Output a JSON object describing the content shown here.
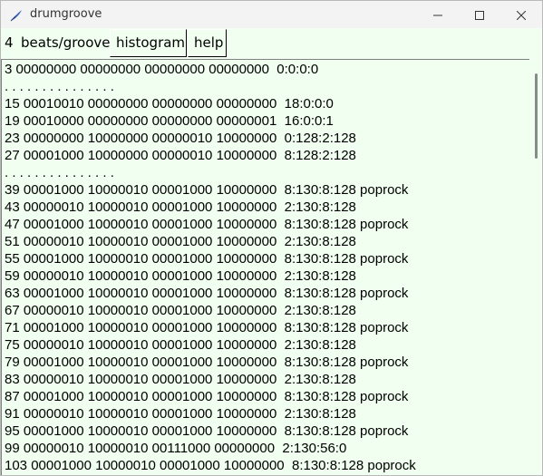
{
  "window": {
    "title": "drumgroove"
  },
  "toolbar": {
    "count": "4",
    "label": "beats/groove",
    "histogram_label": "histogram",
    "help_label": "help"
  },
  "textarea": {
    "lines": [
      "3 00000000 00000000 00000000 00000000  0:0:0:0",
      ". . . . . . . . . . . . . . .",
      "15 00010010 00000000 00000000 00000000  18:0:0:0",
      "19 00010000 00000000 00000000 00000001  16:0:0:1",
      "23 00000000 10000000 00000010 10000000  0:128:2:128",
      "27 00001000 10000000 00000010 10000000  8:128:2:128",
      ". . . . . . . . . . . . . . .",
      "39 00001000 10000010 00001000 10000000  8:130:8:128 poprock",
      "43 00000010 10000010 00001000 10000000  2:130:8:128",
      "47 00001000 10000010 00001000 10000000  8:130:8:128 poprock",
      "51 00000010 10000010 00001000 10000000  2:130:8:128",
      "55 00001000 10000010 00001000 10000000  8:130:8:128 poprock",
      "59 00000010 10000010 00001000 10000000  2:130:8:128",
      "63 00001000 10000010 00001000 10000000  8:130:8:128 poprock",
      "67 00000010 10000010 00001000 10000000  2:130:8:128",
      "71 00001000 10000010 00001000 10000000  8:130:8:128 poprock",
      "75 00000010 10000010 00001000 10000000  2:130:8:128",
      "79 00001000 10000010 00001000 10000000  8:130:8:128 poprock",
      "83 00000010 10000010 00001000 10000000  2:130:8:128",
      "87 00001000 10000010 00001000 10000000  8:130:8:128 poprock",
      "91 00000010 10000010 00001000 10000000  2:130:8:128",
      "95 00001000 10000010 00001000 10000000  8:130:8:128 poprock",
      "99 00000010 10000010 00111000 00000000  2:130:56:0",
      "103 00001000 10000010 00001000 10000000  8:130:8:128 poprock"
    ]
  },
  "icons": {
    "app": "feather-icon",
    "minimize": "minimize-icon",
    "maximize": "maximize-icon",
    "close": "close-icon"
  }
}
